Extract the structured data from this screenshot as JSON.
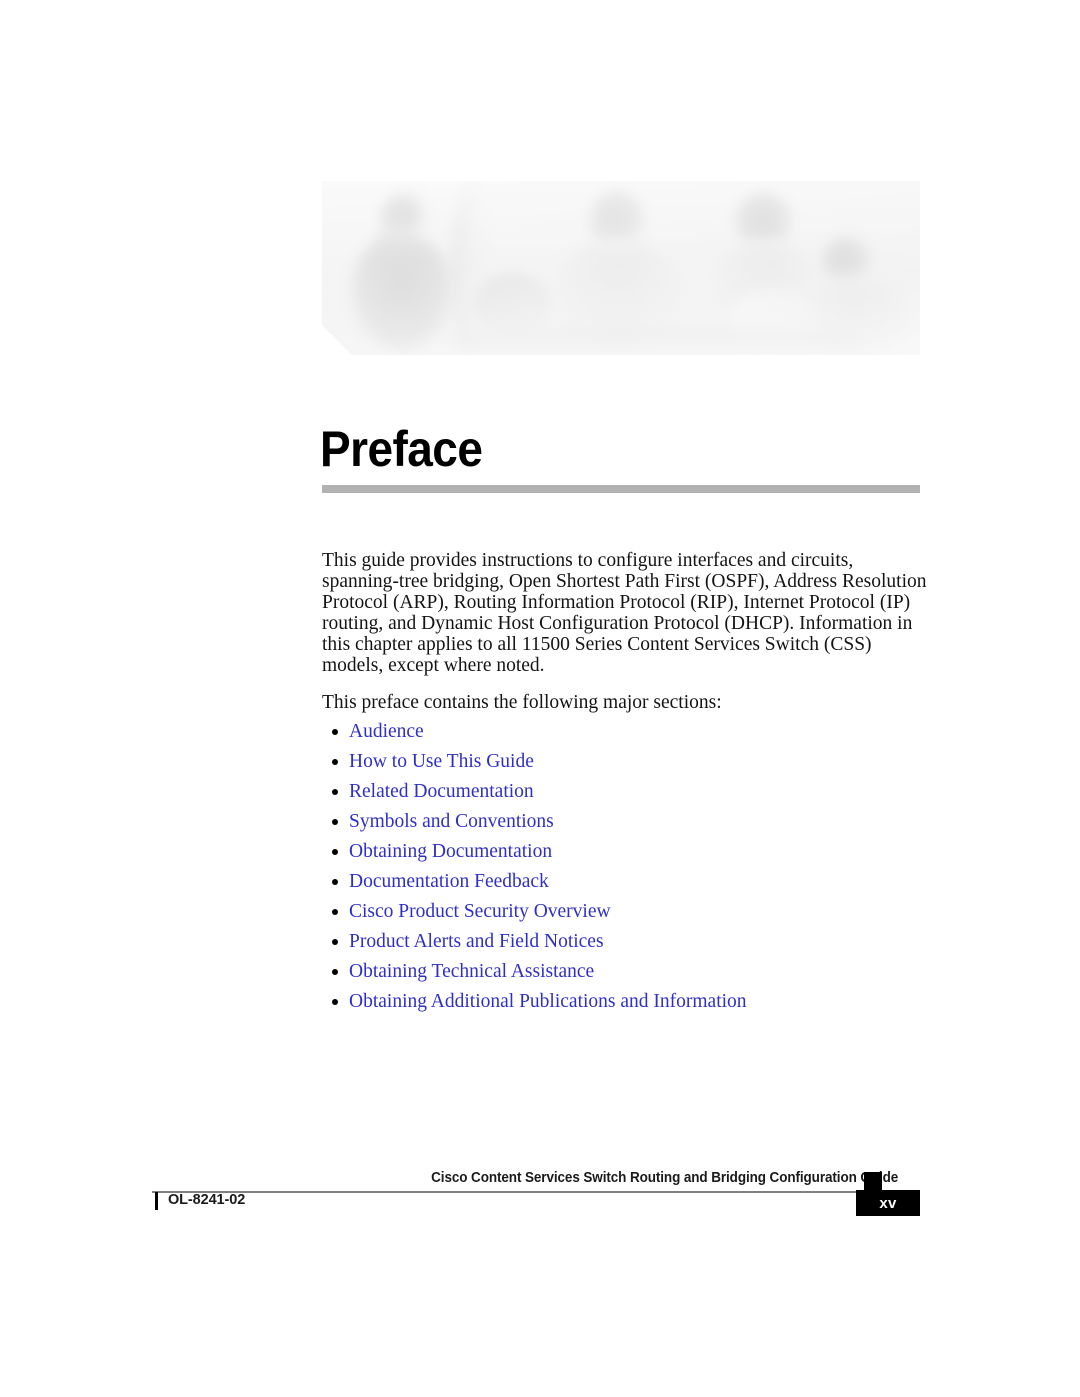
{
  "document": {
    "chapter_title": "Preface",
    "banner_alt": "cisco-people-banner-photo"
  },
  "body": {
    "intro_paragraph": "This guide provides instructions to configure interfaces and circuits, spanning-tree bridging, Open Shortest Path First (OSPF), Address Resolution Protocol (ARP), Routing Information Protocol (RIP), Internet Protocol (IP) routing, and Dynamic Host Configuration Protocol (DHCP). Information in this chapter applies to all 11500 Series Content Services Switch (CSS) models, except where noted.",
    "lead_in": "This preface contains the following major sections:",
    "sections": [
      {
        "label": "Audience"
      },
      {
        "label": "How to Use This Guide"
      },
      {
        "label": "Related Documentation"
      },
      {
        "label": "Symbols and Conventions"
      },
      {
        "label": "Obtaining Documentation"
      },
      {
        "label": "Documentation Feedback"
      },
      {
        "label": "Cisco Product Security Overview"
      },
      {
        "label": "Product Alerts and Field Notices"
      },
      {
        "label": "Obtaining Technical Assistance"
      },
      {
        "label": "Obtaining Additional Publications and Information"
      }
    ]
  },
  "footer": {
    "guide_title": "Cisco Content Services Switch Routing and Bridging Configuration Guide",
    "doc_id": "OL-8241-02",
    "page_number": "xv"
  },
  "colors": {
    "link_blue": "#2f2fc6",
    "title_rule_gray": "#b2b2b2",
    "footer_rule_gray": "#808080",
    "page_box_black": "#000000"
  }
}
